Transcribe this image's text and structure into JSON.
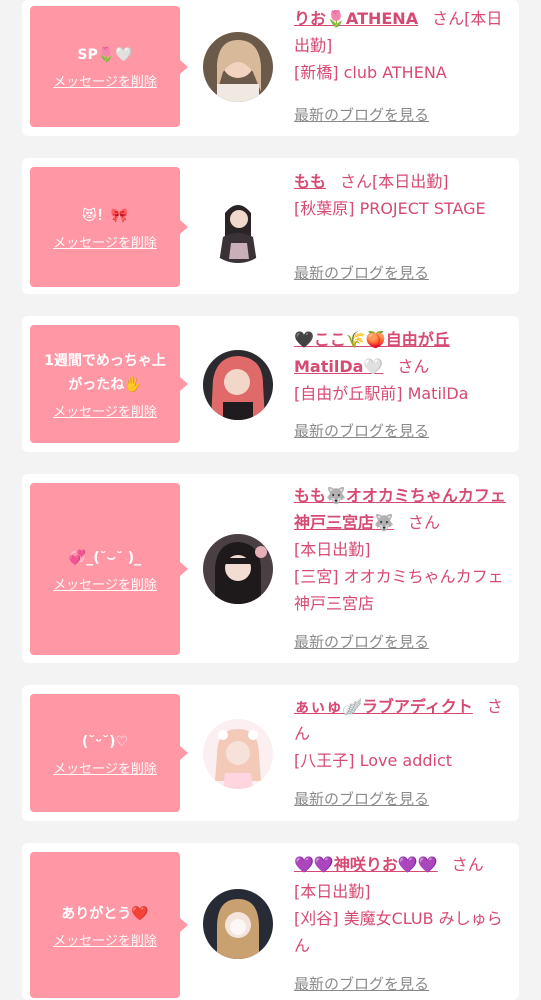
{
  "cards": [
    {
      "message": "SP🌷🤍",
      "delete_label": "メッセージを削除",
      "name": "りお🌷ATHENA",
      "san": "さん",
      "status": "[本日出勤]",
      "shop": "[新橋] club ATHENA",
      "blog_label": "最新のブログを見る"
    },
    {
      "message": "😻！🎀",
      "delete_label": "メッセージを削除",
      "name": "もも",
      "san": "さん",
      "status": "[本日出勤]",
      "shop": "[秋葉原] PROJECT STAGE",
      "blog_label": "最新のブログを見る"
    },
    {
      "message": "1週間でめっちゃ上がったね🖐",
      "delete_label": "メッセージを削除",
      "name": "🖤ここ🌾🍑自由が丘MatilDa🤍",
      "san": "さん",
      "status": "",
      "shop": "[自由が丘駅前] MatilDa",
      "blog_label": "最新のブログを見る"
    },
    {
      "message": "💞_(˘⌣˘ )_",
      "delete_label": "メッセージを削除",
      "name": "もも🐺オオカミちゃんカフェ神戸三宮店🐺",
      "san": "さん",
      "status": "[本日出勤]",
      "shop": "[三宮] オオカミちゃんカフェ神戸三宮店",
      "blog_label": "最新のブログを見る"
    },
    {
      "message": "(˘ᵕ˘)♡",
      "delete_label": "メッセージを削除",
      "name": "ぁぃゅ🪽ラブアディクト",
      "san": "さん",
      "status": "",
      "shop": "[八王子] Love addict",
      "blog_label": "最新のブログを見る"
    },
    {
      "message": "ありがとう❤️",
      "delete_label": "メッセージを削除",
      "name": "💜💜神咲りお💜💜",
      "san": "さん",
      "status": "[本日出勤]",
      "shop": "[刈谷] 美魔女CLUB みしゅらん",
      "blog_label": "最新のブログを見る"
    }
  ],
  "colors": {
    "bubble": "#ff97a5",
    "accent": "#d74a72",
    "muted": "#8a8a8a",
    "background": "#f3f3f3"
  }
}
